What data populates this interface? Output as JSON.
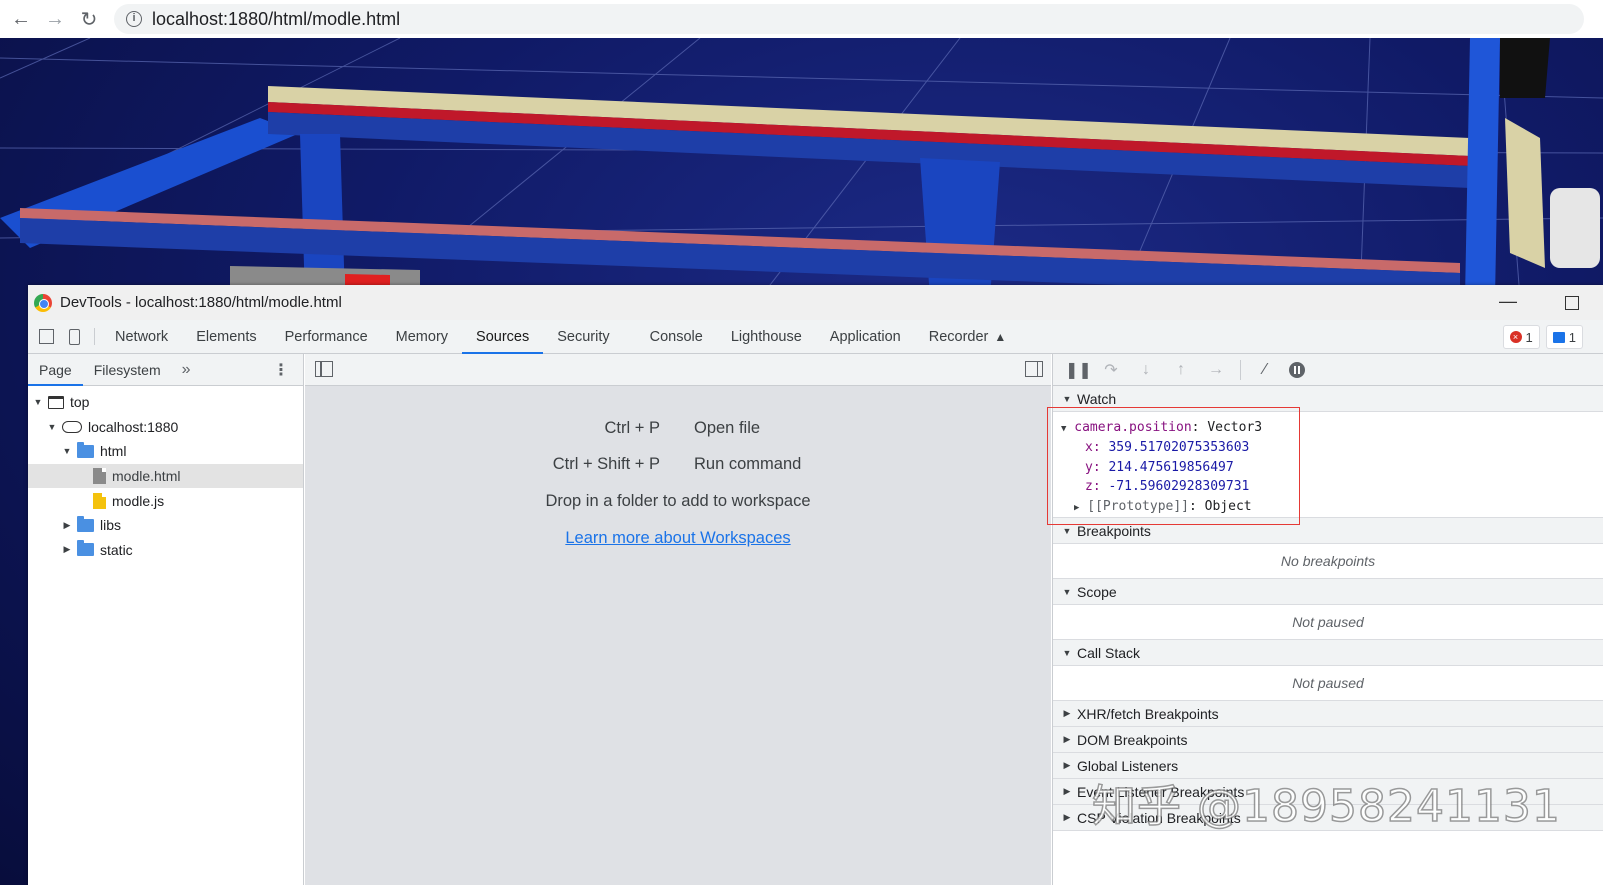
{
  "browser": {
    "url": "localhost:1880/html/modle.html",
    "back_icon": "arrow-left-icon",
    "forward_icon": "arrow-right-icon",
    "reload_icon": "reload-icon",
    "info_icon": "info-icon"
  },
  "devtools": {
    "window_title": "DevTools - localhost:1880/html/modle.html",
    "tabs": [
      {
        "label": "Network"
      },
      {
        "label": "Elements"
      },
      {
        "label": "Performance"
      },
      {
        "label": "Memory"
      },
      {
        "label": "Sources",
        "active": true
      },
      {
        "label": "Security"
      },
      {
        "label": "Console"
      },
      {
        "label": "Lighthouse"
      },
      {
        "label": "Application"
      },
      {
        "label": "Recorder"
      }
    ],
    "error_count": "1",
    "message_count": "1",
    "colors": {
      "accent": "#1a73e8",
      "error": "#d93025",
      "highlight": "#e53935"
    }
  },
  "navigator": {
    "tabs": [
      "Page",
      "Filesystem"
    ],
    "more": "»",
    "tree": [
      {
        "label": "top",
        "depth": 0,
        "icon": "frame-icon",
        "expanded": true
      },
      {
        "label": "localhost:1880",
        "depth": 1,
        "icon": "cloud-icon",
        "expanded": true
      },
      {
        "label": "html",
        "depth": 2,
        "icon": "folder-icon",
        "expanded": true
      },
      {
        "label": "modle.html",
        "depth": 3,
        "icon": "html-file-icon",
        "selected": true
      },
      {
        "label": "modle.js",
        "depth": 3,
        "icon": "js-file-icon"
      },
      {
        "label": "libs",
        "depth": 2,
        "icon": "folder-icon",
        "expanded": false
      },
      {
        "label": "static",
        "depth": 2,
        "icon": "folder-icon",
        "expanded": false
      }
    ]
  },
  "editor": {
    "shortcuts": [
      {
        "keys": "Ctrl + P",
        "label": "Open file"
      },
      {
        "keys": "Ctrl + Shift + P",
        "label": "Run command"
      }
    ],
    "drop_text": "Drop in a folder to add to workspace",
    "link_text": "Learn more about Workspaces"
  },
  "debugger": {
    "sections": {
      "watch": "Watch",
      "breakpoints": "Breakpoints",
      "scope": "Scope",
      "call_stack": "Call Stack",
      "xhr": "XHR/fetch Breakpoints",
      "dom": "DOM Breakpoints",
      "global": "Global Listeners",
      "event": "Event Listener Breakpoints",
      "csp": "CSP Violation Breakpoints"
    },
    "watch": {
      "expression": "camera.position",
      "type": "Vector3",
      "x": "359.51702075353603",
      "y": "214.475619856497",
      "z": "-71.59602928309731",
      "prototype_key": "[[Prototype]]",
      "prototype_val": "Object"
    },
    "no_breakpoints": "No breakpoints",
    "scope_status": "Not paused",
    "callstack_status": "Not paused"
  },
  "watermark": "知乎 @18958241131"
}
